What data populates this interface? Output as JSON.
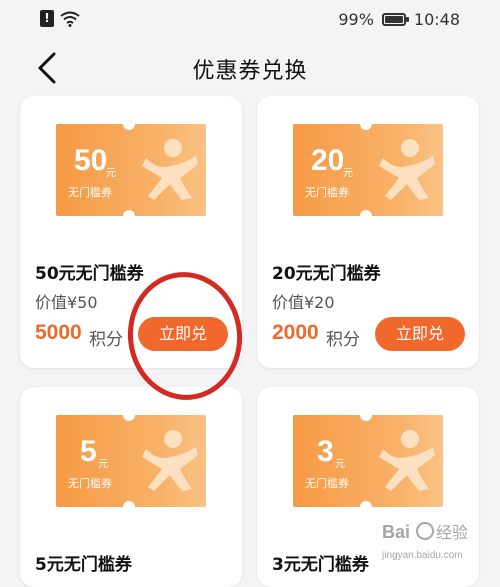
{
  "status_bar": {
    "battery": "99%",
    "time": "10:48",
    "icons": [
      "sim-alert-icon",
      "wifi-icon",
      "battery-icon"
    ]
  },
  "header": {
    "title": "优惠券兑换",
    "back_icon": "back-arrow-icon"
  },
  "coupons": [
    {
      "amount": "50",
      "unit": "元",
      "desc": "无门槛券",
      "name": "50元无门槛券",
      "value": "价值¥50",
      "points": "5000",
      "points_label": "积分",
      "button": "立即兑"
    },
    {
      "amount": "20",
      "unit": "元",
      "desc": "无门槛券",
      "name": "20元无门槛券",
      "value": "价值¥20",
      "points": "2000",
      "points_label": "积分",
      "button": "立即兑"
    },
    {
      "amount": "5",
      "unit": "元",
      "desc": "无门槛券",
      "name": "5元无门槛券"
    },
    {
      "amount": "3",
      "unit": "元",
      "desc": "无门槛券",
      "name": "3元无门槛券"
    }
  ],
  "annotation": {
    "highlight_color": "#d42a22"
  },
  "colors": {
    "accent": "#f0682b",
    "points": "#ee6a2a",
    "coupon_start": "#f59a45",
    "coupon_end": "#fac285"
  },
  "watermark": "Bai百 经验 jingyan.baidu.com"
}
